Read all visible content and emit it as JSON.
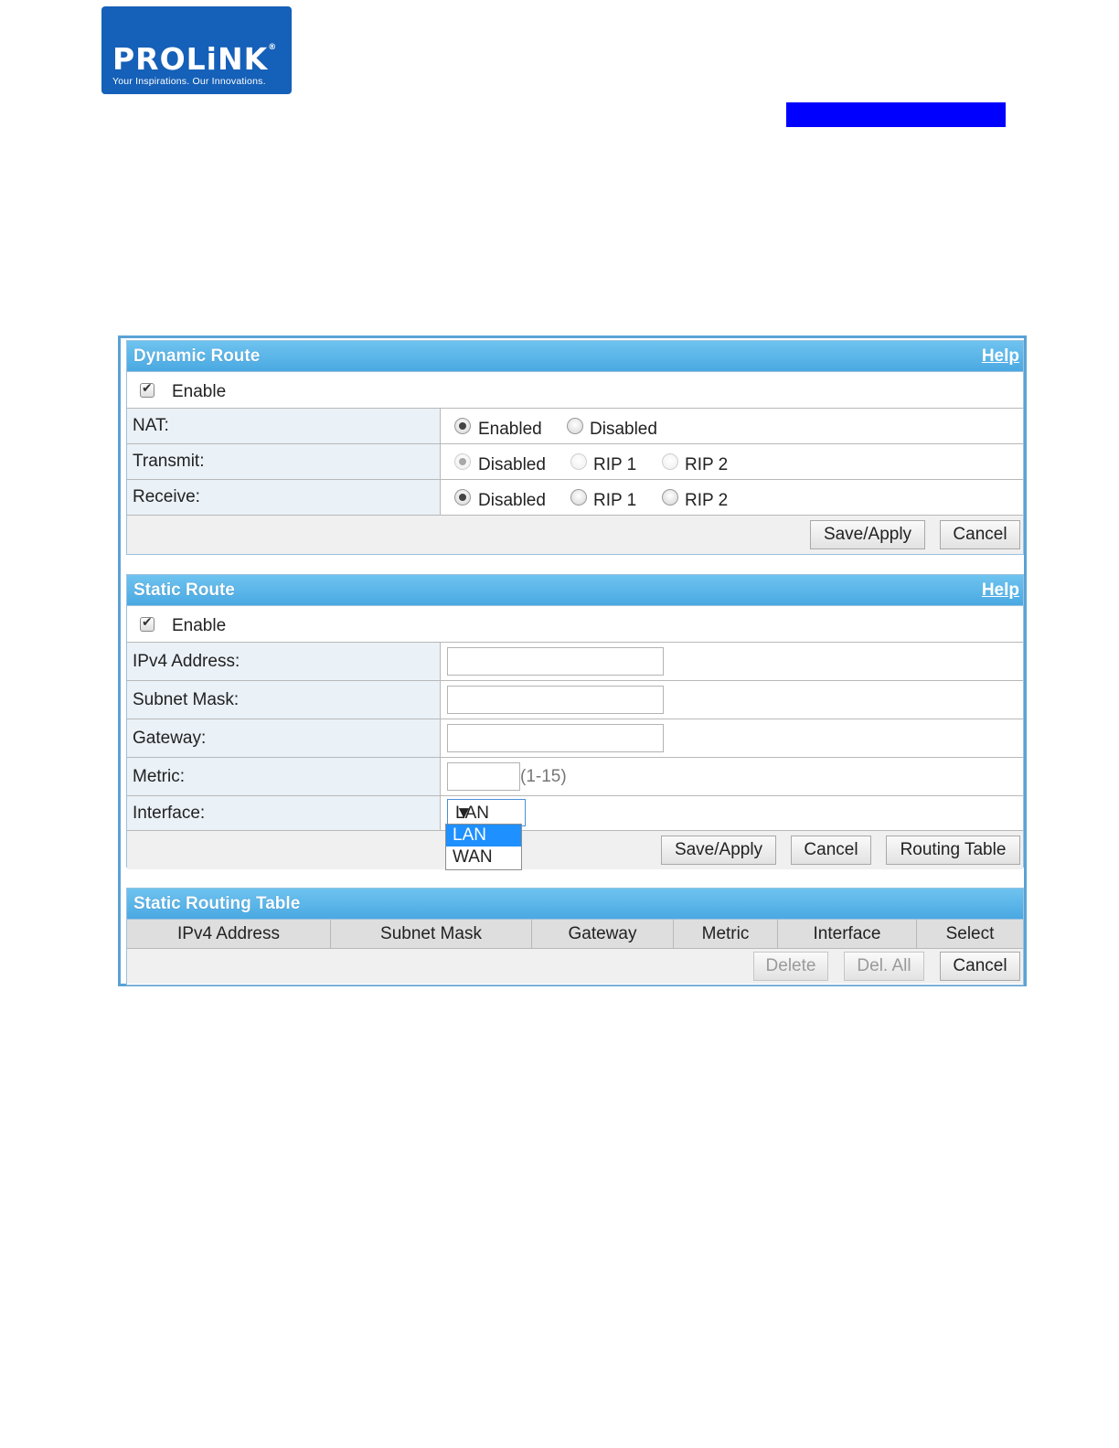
{
  "logo": {
    "word": "PROLiNK",
    "registered": "®",
    "tagline": "Your Inspirations. Our Innovations."
  },
  "colors": {
    "header": "#4aa9e2",
    "logo": "#1560b8",
    "top_bar": "#0000ff",
    "label_bg": "#eaf1f7"
  },
  "dynamic_route": {
    "title": "Dynamic Route",
    "help": "Help",
    "enable_label": "Enable",
    "enable_checked": true,
    "nat": {
      "label": "NAT:",
      "options": [
        "Enabled",
        "Disabled"
      ],
      "selected": "Enabled"
    },
    "transmit": {
      "label": "Transmit:",
      "options": [
        "Disabled",
        "RIP 1",
        "RIP 2"
      ],
      "selected": "Disabled"
    },
    "receive": {
      "label": "Receive:",
      "options": [
        "Disabled",
        "RIP 1",
        "RIP 2"
      ],
      "selected": "Disabled"
    },
    "save_label": "Save/Apply",
    "cancel_label": "Cancel"
  },
  "static_route": {
    "title": "Static Route",
    "help": "Help",
    "enable_label": "Enable",
    "enable_checked": true,
    "ipv4_label": "IPv4 Address:",
    "subnet_label": "Subnet Mask:",
    "gateway_label": "Gateway:",
    "metric_label": "Metric:",
    "metric_hint": "(1-15)",
    "interface_label": "Interface:",
    "interface_value": "LAN",
    "interface_options": [
      "LAN",
      "WAN"
    ],
    "save_label": "Save/Apply",
    "cancel_label": "Cancel",
    "routing_table_label": "Routing Table"
  },
  "static_routing_table": {
    "title": "Static Routing Table",
    "columns": [
      "IPv4 Address",
      "Subnet Mask",
      "Gateway",
      "Metric",
      "Interface",
      "Select"
    ],
    "delete_label": "Delete",
    "del_all_label": "Del. All",
    "cancel_label": "Cancel"
  }
}
